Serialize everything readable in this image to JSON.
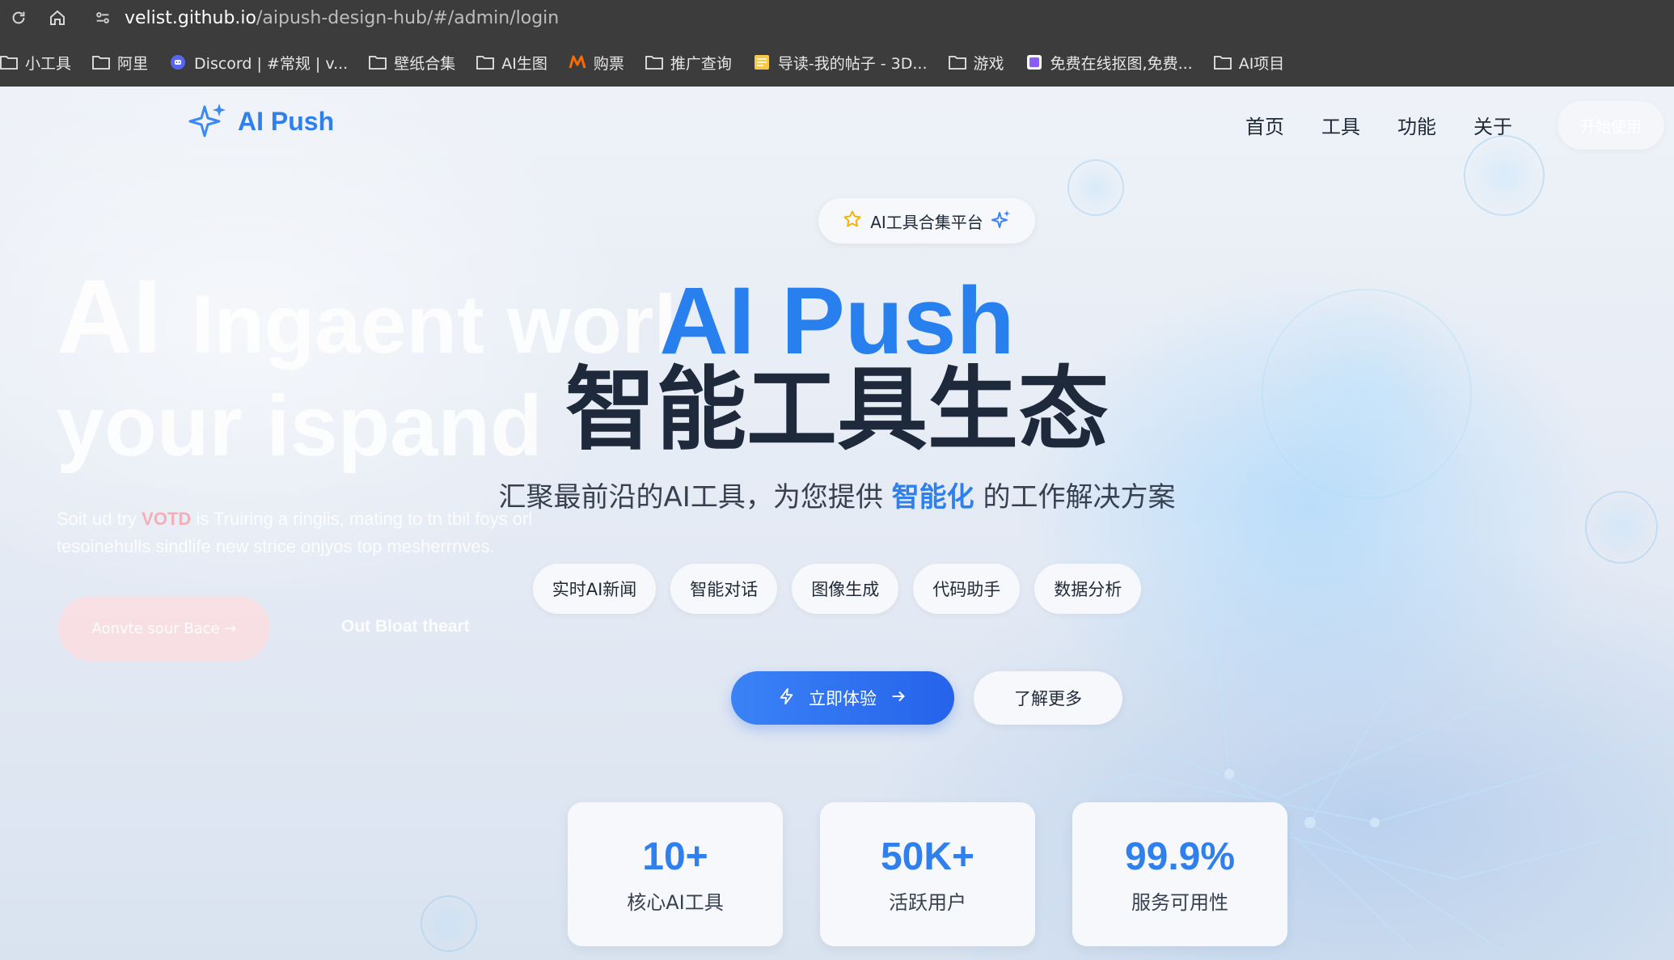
{
  "browser": {
    "url_host": "velist.github.io",
    "url_path": "/aipush-design-hub/#/admin/login",
    "bookmarks": [
      {
        "label": "小工具",
        "icon": "folder-icon"
      },
      {
        "label": "阿里",
        "icon": "folder-icon"
      },
      {
        "label": "Discord | #常规 | v...",
        "icon": "discord-icon"
      },
      {
        "label": "壁纸合集",
        "icon": "folder-icon"
      },
      {
        "label": "AI生图",
        "icon": "folder-icon"
      },
      {
        "label": "购票",
        "icon": "m-logo-icon"
      },
      {
        "label": "推广查询",
        "icon": "folder-icon"
      },
      {
        "label": "导读-我的帖子 - 3D...",
        "icon": "note-icon"
      },
      {
        "label": "游戏",
        "icon": "folder-icon"
      },
      {
        "label": "免费在线抠图,免费...",
        "icon": "app-icon"
      },
      {
        "label": "AI项目",
        "icon": "folder-icon"
      }
    ]
  },
  "header": {
    "logo_text": "AI Push",
    "menu": [
      "首页",
      "工具",
      "功能",
      "关于"
    ],
    "start_label": "开始使用"
  },
  "background": {
    "ghost_line1_a": "AI",
    "ghost_line1_b": "Ingaent worl",
    "ghost_line2": "your ispand",
    "ghost_sub_a": "Soit ud try",
    "ghost_sub_red": "VOTD",
    "ghost_sub_b": "is Truiring a ringiis, mating to tn tbil foys orl",
    "ghost_sub_line2": "tesoinehulls sindlife new strice onjyos top mesherrnves.",
    "ghost_button": "Aonvte sour Bace →",
    "ghost_link": "Out Bloat theart"
  },
  "hero": {
    "badge": "AI工具合集平台",
    "title_line1": "AI Push",
    "title_line2": "智能工具生态",
    "subtitle_before": "汇聚最前沿的AI工具，为您提供",
    "subtitle_highlight": "智能化",
    "subtitle_after": "的工作解决方案",
    "chips": [
      "实时AI新闻",
      "智能对话",
      "图像生成",
      "代码助手",
      "数据分析"
    ],
    "cta_label": "立即体验",
    "more_label": "了解更多"
  },
  "stats": [
    {
      "value": "10+",
      "label": "核心AI工具"
    },
    {
      "value": "50K+",
      "label": "活跃用户"
    },
    {
      "value": "99.9%",
      "label": "服务可用性"
    }
  ],
  "colors": {
    "brand": "#2f80ed",
    "title_dark": "#1e293b",
    "chrome": "#3c3c3c"
  }
}
